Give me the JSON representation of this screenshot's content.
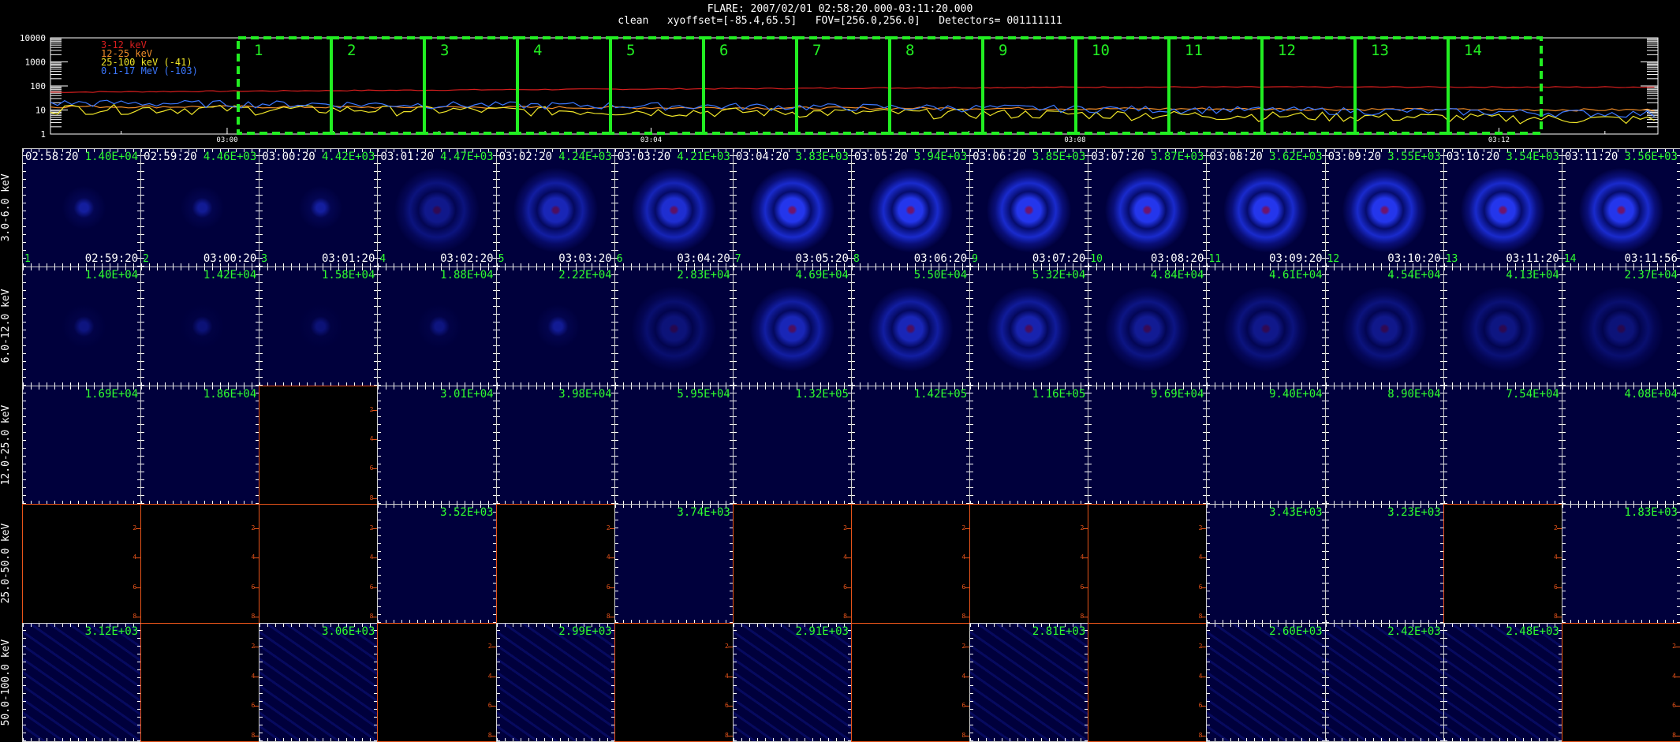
{
  "header": {
    "line1": "FLARE: 2007/02/01 02:58:20.000-03:11:20.000",
    "line2": "clean   xyoffset=[-85.4,65.5]   FOV=[256.0,256.0]   Detectors= 001111111"
  },
  "colors": {
    "grid_border": "#cfcfcf",
    "blank_border": "#e8541a",
    "label_green": "#2fff2f",
    "image_bg": "#00003c",
    "interval_box": "#22ee22"
  },
  "lightcurve": {
    "legend": [
      {
        "label": "3-12 keV",
        "color": "#d81e1e"
      },
      {
        "label": "12-25 keV",
        "color": "#f08c28"
      },
      {
        "label": "25-100 keV (-41)",
        "color": "#f0e628"
      },
      {
        "label": "0.1-17 MeV (-103)",
        "color": "#3c78ff"
      }
    ],
    "y_ticks": [
      "10000",
      "1000",
      "100",
      "10",
      "1"
    ],
    "x_ticks": [
      "03:00",
      "03:04",
      "03:08",
      "03:12"
    ],
    "intervals": [
      "1",
      "2",
      "3",
      "4",
      "5",
      "6",
      "7",
      "8",
      "9",
      "10",
      "11",
      "12",
      "13",
      "14"
    ]
  },
  "grid": {
    "energy_bands": [
      "3.0-6.0 keV",
      "6.0-12.0 keV",
      "12.0-25.0 keV",
      "25.0-50.0 keV",
      "50.0-100.0 keV"
    ],
    "start_times": [
      "02:58:20",
      "02:59:20",
      "03:00:20",
      "03:01:20",
      "03:02:20",
      "03:03:20",
      "03:04:20",
      "03:05:20",
      "03:06:20",
      "03:07:20",
      "03:08:20",
      "03:09:20",
      "03:10:20",
      "03:11:20"
    ],
    "end_times": [
      "02:59:20",
      "03:00:20",
      "03:01:20",
      "03:02:20",
      "03:03:20",
      "03:04:20",
      "03:05:20",
      "03:06:20",
      "03:07:20",
      "03:08:20",
      "03:09:20",
      "03:10:20",
      "03:11:20",
      "03:11:56"
    ],
    "index_labels": [
      "1",
      "2",
      "3",
      "4",
      "5",
      "6",
      "7",
      "8",
      "9",
      "10",
      "11",
      "12",
      "13",
      "14"
    ],
    "max_values": [
      [
        "1.40E+04",
        "4.46E+03",
        "4.42E+03",
        "4.47E+03",
        "4.24E+03",
        "4.21E+03",
        "3.83E+03",
        "3.94E+03",
        "3.85E+03",
        "3.87E+03",
        "3.62E+03",
        "3.55E+03",
        "3.54E+03",
        "3.56E+03"
      ],
      [
        "1.40E+04",
        "1.42E+04",
        "1.58E+04",
        "1.88E+04",
        "2.22E+04",
        "2.83E+04",
        "4.69E+04",
        "5.50E+04",
        "5.32E+04",
        "4.84E+04",
        "4.61E+04",
        "4.54E+04",
        "4.13E+04",
        "2.37E+04"
      ],
      [
        "1.69E+04",
        "1.86E+04",
        "",
        "3.01E+04",
        "3.98E+04",
        "5.95E+04",
        "1.32E+05",
        "1.42E+05",
        "1.16E+05",
        "9.69E+04",
        "9.40E+04",
        "8.90E+04",
        "7.54E+04",
        "4.08E+04"
      ],
      [
        "",
        "",
        "",
        "3.52E+03",
        "",
        "3.74E+03",
        "",
        "",
        "",
        "",
        "3.43E+03",
        "3.23E+03",
        "",
        "1.83E+03"
      ],
      [
        "3.12E+03",
        "",
        "3.06E+03",
        "",
        "2.99E+03",
        "",
        "2.91E+03",
        "",
        "2.81E+03",
        "",
        "2.60E+03",
        "2.42E+03",
        "2.48E+03",
        ""
      ]
    ],
    "blank_ticks": [
      "2",
      "4",
      "6",
      "8"
    ]
  }
}
